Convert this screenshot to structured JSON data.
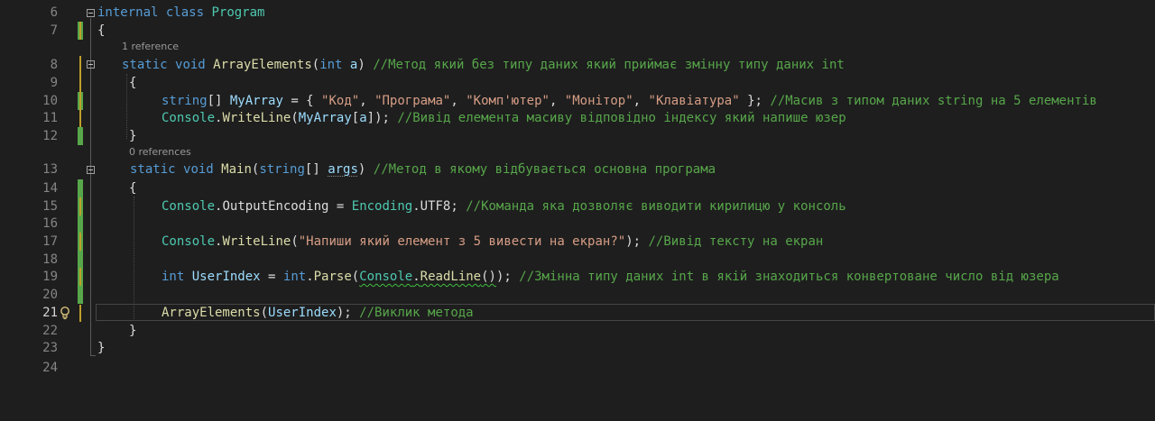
{
  "editor": {
    "current_line": "21",
    "lines": [
      {
        "n": "6"
      },
      {
        "n": "7"
      },
      {
        "n": "8"
      },
      {
        "n": "9"
      },
      {
        "n": "10"
      },
      {
        "n": "11"
      },
      {
        "n": "12"
      },
      {
        "n": "13"
      },
      {
        "n": "14"
      },
      {
        "n": "15"
      },
      {
        "n": "16"
      },
      {
        "n": "17"
      },
      {
        "n": "18"
      },
      {
        "n": "19"
      },
      {
        "n": "20"
      },
      {
        "n": "21"
      },
      {
        "n": "22"
      },
      {
        "n": "23"
      },
      {
        "n": "24"
      }
    ],
    "codelens": {
      "array_elements": "1 reference",
      "main": "0 references"
    },
    "code": {
      "l6": {
        "internal": "internal",
        "class": "class",
        "name": "Program"
      },
      "l7": {
        "brace": "{"
      },
      "l8": {
        "static": "static",
        "void": "void",
        "fn": "ArrayElements",
        "p1": "(",
        "int": "int",
        "a": "a",
        "p2": ")",
        "comment": "//Метод який без типу даних який приймає змінну типу даних int"
      },
      "l9": {
        "brace": "{"
      },
      "l10": {
        "string": "string",
        "br": "[] ",
        "var": "MyArray",
        "eq": " = { ",
        "s1": "\"Код\"",
        "c1": ", ",
        "s2": "\"Програма\"",
        "c2": ", ",
        "s3": "\"Комп'ютер\"",
        "c3": ", ",
        "s4": "\"Монітор\"",
        "c4": ", ",
        "s5": "\"Клавіатура\"",
        "end": " }; ",
        "comment": "//Масив з типом даних string на 5 елементів"
      },
      "l11": {
        "cls": "Console",
        "dot": ".",
        "fn": "WriteLine",
        "p1": "(",
        "var": "MyArray",
        "b1": "[",
        "a": "a",
        "b2": "]",
        "p2": "); ",
        "comment": "//Вивід елемента масиву відповідно індексу який напише юзер"
      },
      "l12": {
        "brace": "}"
      },
      "l13": {
        "static": "static",
        "void": "void",
        "fn": "Main",
        "p1": "(",
        "string": "string",
        "br": "[] ",
        "args": "args",
        "p2": ") ",
        "comment": "//Метод в якому відбувається основна програма"
      },
      "l14": {
        "brace": "{"
      },
      "l15": {
        "cls": "Console",
        "dot": ".",
        "prop": "OutputEncoding",
        "eq": " = ",
        "enc": "Encoding",
        "dot2": ".",
        "utf": "UTF8",
        "end": "; ",
        "comment": "//Команда яка дозволяє виводити кирилицю у консоль"
      },
      "l17": {
        "cls": "Console",
        "dot": ".",
        "fn": "WriteLine",
        "p1": "(",
        "str": "\"Напиши який елемент з 5 вивести на екран?\"",
        "p2": "); ",
        "comment": "//Вивід тексту на екран"
      },
      "l19": {
        "int": "int",
        "var": "UserIndex",
        "eq": " = ",
        "int2": "int",
        "dot": ".",
        "fn": "Parse",
        "p1": "(",
        "cls": "Console",
        "dot2": ".",
        "fn2": "ReadLine",
        "p2": "()",
        "p3": "); ",
        "comment": "//Змінна типу даних int в якій знаходиться конвертоване число від юзера"
      },
      "l21": {
        "fn": "ArrayElements",
        "p1": "(",
        "var": "UserIndex",
        "p2": "); ",
        "comment": "//Виклик метода"
      },
      "l22": {
        "brace": "}"
      },
      "l23": {
        "brace": "}"
      }
    }
  },
  "colors": {
    "background": "#1e1e1e",
    "keyword": "#569cd6",
    "type": "#4ec9b0",
    "method": "#dcdcaa",
    "identifier": "#9cdcfe",
    "string": "#d69d85",
    "comment": "#57a64a",
    "changed_bar": "#57a64a",
    "modified_bar": "#bfa02a"
  },
  "icons": {
    "lightbulb": "lightbulb-icon",
    "fold": "collapse-icon"
  }
}
